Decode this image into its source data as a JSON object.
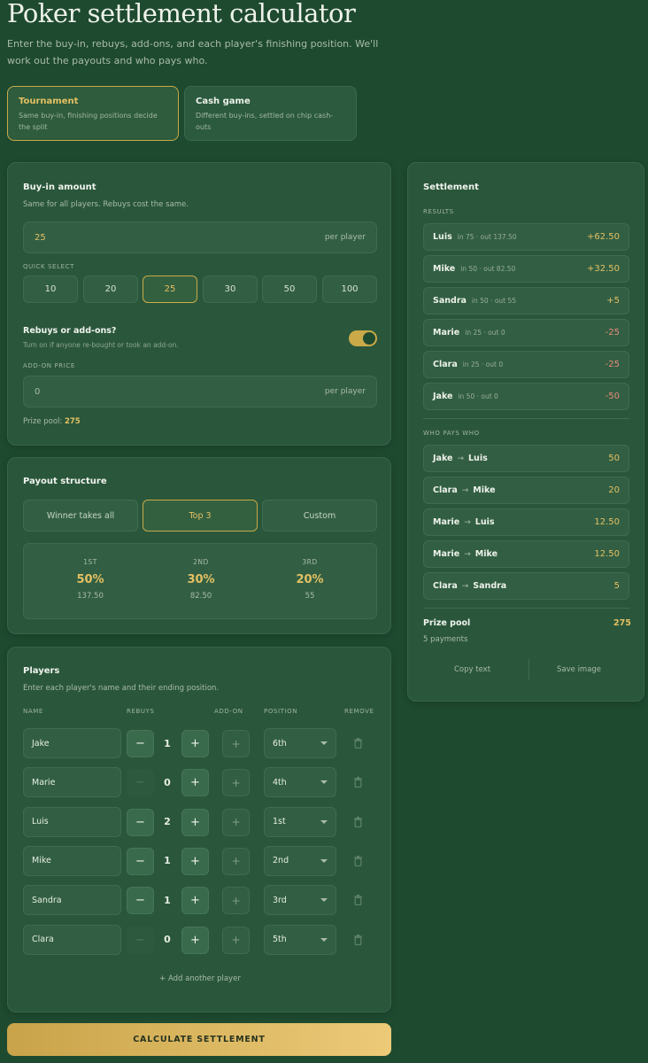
{
  "page": {
    "title": "Poker settlement calculator",
    "subtitle": "Enter the buy-in, rebuys, add-ons, and each player's finishing position. We'll work out the payouts and who pays who."
  },
  "modes": [
    {
      "title": "Tournament",
      "desc": "Same buy-in, finishing positions decide the split",
      "active": true
    },
    {
      "title": "Cash game",
      "desc": "Different buy-ins, settled on chip cash-outs",
      "active": false
    }
  ],
  "buyin": {
    "title": "Buy-in amount",
    "sub": "Same for all players. Rebuys cost the same.",
    "value": "25",
    "unit": "per player",
    "quick_label": "QUICK SELECT",
    "quick": [
      "10",
      "20",
      "25",
      "30",
      "50",
      "100"
    ],
    "quick_active": "25",
    "rebuy_title": "Rebuys or add-ons?",
    "rebuy_sub": "Turn on if anyone re-bought or took an add-on.",
    "rebuy_on": true,
    "addon_label": "ADD-ON PRICE",
    "addon_value": "0",
    "addon_unit": "per player",
    "prize_label": "Prize pool:",
    "prize_value": "275"
  },
  "payout": {
    "title": "Payout structure",
    "options": [
      "Winner takes all",
      "Top 3",
      "Custom"
    ],
    "active": "Top 3",
    "places": [
      {
        "place": "1ST",
        "pct": "50%",
        "amount": "137.50"
      },
      {
        "place": "2ND",
        "pct": "30%",
        "amount": "82.50"
      },
      {
        "place": "3RD",
        "pct": "20%",
        "amount": "55"
      }
    ]
  },
  "players": {
    "title": "Players",
    "sub": "Enter each player's name and their ending position.",
    "headers": [
      "NAME",
      "REBUYS",
      "ADD-ON",
      "POSITION",
      "REMOVE"
    ],
    "rows": [
      {
        "name": "Jake",
        "rebuys": "1",
        "position": "6th",
        "minus_enabled": true
      },
      {
        "name": "Marie",
        "rebuys": "0",
        "position": "4th",
        "minus_enabled": false
      },
      {
        "name": "Luis",
        "rebuys": "2",
        "position": "1st",
        "minus_enabled": true
      },
      {
        "name": "Mike",
        "rebuys": "1",
        "position": "2nd",
        "minus_enabled": true
      },
      {
        "name": "Sandra",
        "rebuys": "1",
        "position": "3rd",
        "minus_enabled": true
      },
      {
        "name": "Clara",
        "rebuys": "0",
        "position": "5th",
        "minus_enabled": false
      }
    ],
    "add_label": "+ Add another player"
  },
  "calculate_label": "CALCULATE SETTLEMENT",
  "settlement": {
    "title": "Settlement",
    "results_label": "RESULTS",
    "results": [
      {
        "name": "Luis",
        "detail": "in 75 · out 137.50",
        "amount": "+62.50",
        "sign": "pos"
      },
      {
        "name": "Mike",
        "detail": "in 50 · out 82.50",
        "amount": "+32.50",
        "sign": "pos"
      },
      {
        "name": "Sandra",
        "detail": "in 50 · out 55",
        "amount": "+5",
        "sign": "pos"
      },
      {
        "name": "Marie",
        "detail": "in 25 · out 0",
        "amount": "-25",
        "sign": "neg"
      },
      {
        "name": "Clara",
        "detail": "in 25 · out 0",
        "amount": "-25",
        "sign": "neg"
      },
      {
        "name": "Jake",
        "detail": "in 50 · out 0",
        "amount": "-50",
        "sign": "neg"
      }
    ],
    "who_label": "WHO PAYS WHO",
    "payments": [
      {
        "from": "Jake",
        "to": "Luis",
        "amount": "50"
      },
      {
        "from": "Clara",
        "to": "Mike",
        "amount": "20"
      },
      {
        "from": "Marie",
        "to": "Luis",
        "amount": "12.50"
      },
      {
        "from": "Marie",
        "to": "Mike",
        "amount": "12.50"
      },
      {
        "from": "Clara",
        "to": "Sandra",
        "amount": "5"
      }
    ],
    "arrow": "→",
    "prize_label": "Prize pool",
    "prize_value": "275",
    "payments_count": "5 payments",
    "copy_label": "Copy text",
    "save_label": "Save image"
  },
  "colors": {
    "background": "#1e4a30",
    "accent": "#e4c063",
    "negative": "#e88a7a"
  }
}
